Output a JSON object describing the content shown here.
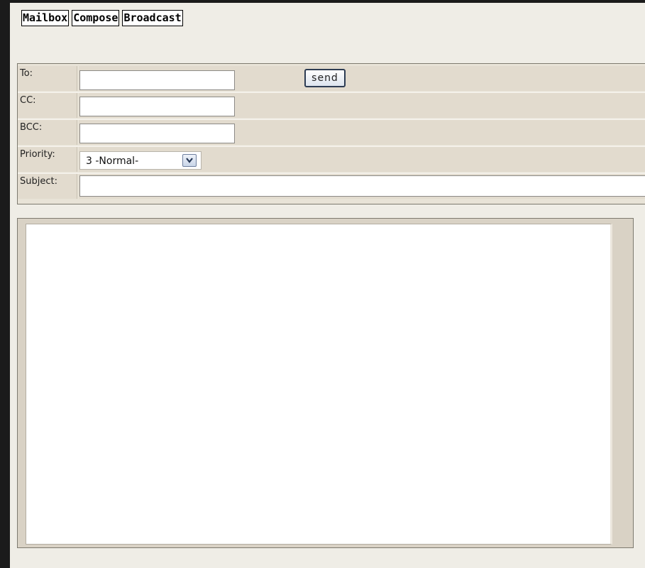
{
  "nav": {
    "tabs": [
      {
        "label": "Mailbox"
      },
      {
        "label": "Compose"
      },
      {
        "label": "Broadcast"
      }
    ]
  },
  "form": {
    "to": {
      "label": "To:",
      "value": ""
    },
    "send_label": "send",
    "cc": {
      "label": "CC:",
      "value": ""
    },
    "bcc": {
      "label": "BCC:",
      "value": ""
    },
    "priority": {
      "label": "Priority:",
      "selected": "3 -Normal-"
    },
    "subject": {
      "label": "Subject:",
      "value": ""
    }
  },
  "body": {
    "value": ""
  },
  "icons": {
    "priority_dropdown": "chevron-down-icon"
  }
}
